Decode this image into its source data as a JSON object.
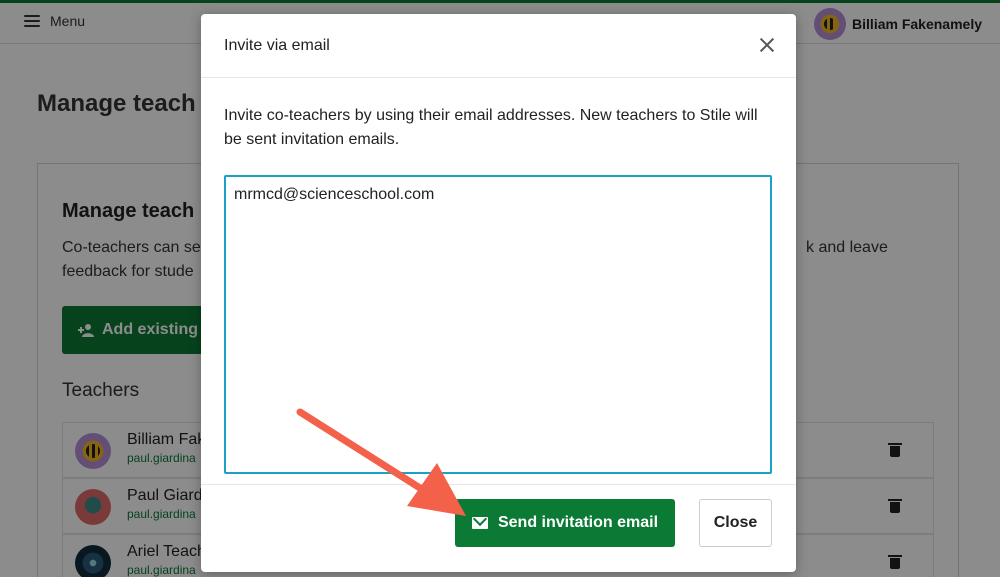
{
  "header": {
    "menu_label": "Menu",
    "user_name": "Billiam Fakenamely"
  },
  "page": {
    "title": "Manage teach",
    "card_title": "Manage teach",
    "card_text_left": "Co-teachers can se",
    "card_text_left_line2": "feedback for stude",
    "card_text_right": "k and leave",
    "add_existing_label": "Add existing",
    "teachers_heading": "Teachers",
    "teachers": [
      {
        "name": "Billiam Fak",
        "email": "paul.giardina"
      },
      {
        "name": "Paul Giard",
        "email": "paul.giardina"
      },
      {
        "name": "Ariel Teach",
        "email": "paul.giardina"
      }
    ]
  },
  "modal": {
    "title": "Invite via email",
    "description": "Invite co-teachers by using their email addresses. New teachers to Stile will be sent invitation emails.",
    "email_value": "mrmcd@scienceschool.com",
    "send_label": "Send invitation email",
    "close_label": "Close"
  },
  "colors": {
    "brand_green": "#0b7a35",
    "focus_blue": "#1ba0c8",
    "annotation_arrow": "#f4614a"
  },
  "icons": {
    "menu": "hamburger-icon",
    "add_user": "add-person-icon",
    "delete": "trash-icon",
    "close": "close-icon",
    "mail": "mail-icon"
  }
}
